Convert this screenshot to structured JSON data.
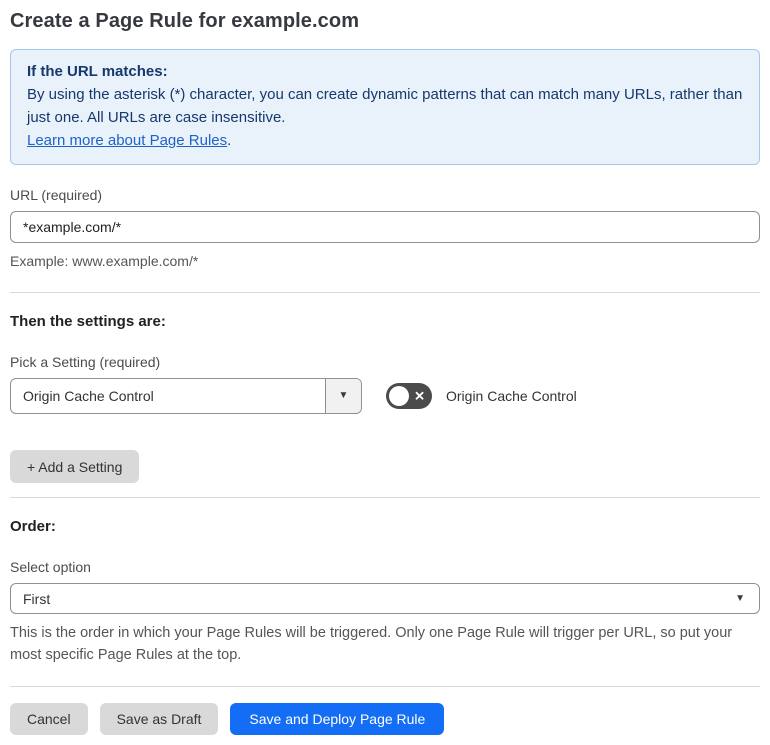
{
  "page": {
    "title": "Create a Page Rule for example.com"
  },
  "info_box": {
    "heading": "If the URL matches:",
    "body": "By using the asterisk (*) character, you can create dynamic patterns that can match many URLs, rather than just one. All URLs are case insensitive.",
    "link_label": "Learn more about Page Rules",
    "link_suffix": "."
  },
  "url_section": {
    "label": "URL (required)",
    "value": "*example.com/*",
    "example": "Example: www.example.com/*"
  },
  "settings_section": {
    "heading": "Then the settings are:",
    "pick_label": "Pick a Setting (required)",
    "selected_setting": "Origin Cache Control",
    "toggle_state": "off",
    "toggle_label": "Origin Cache Control",
    "add_button_label": "+ Add a Setting"
  },
  "order_section": {
    "heading": "Order:",
    "label": "Select option",
    "selected_option": "First",
    "help": "This is the order in which your Page Rules will be triggered. Only one Page Rule will trigger per URL, so put your most specific Page Rules at the top."
  },
  "footer": {
    "cancel_label": "Cancel",
    "save_draft_label": "Save as Draft",
    "save_deploy_label": "Save and Deploy Page Rule"
  },
  "icons": {
    "caret_down": "▼",
    "x_mark": "✕"
  },
  "colors": {
    "info_background": "#e9f2fb",
    "info_border": "#a6c8ee",
    "info_text": "#16386d",
    "link": "#1f62c5",
    "primary_button": "#146ef5",
    "toggle_off": "#4b4b4b",
    "gray_button": "#d9d9d9"
  }
}
